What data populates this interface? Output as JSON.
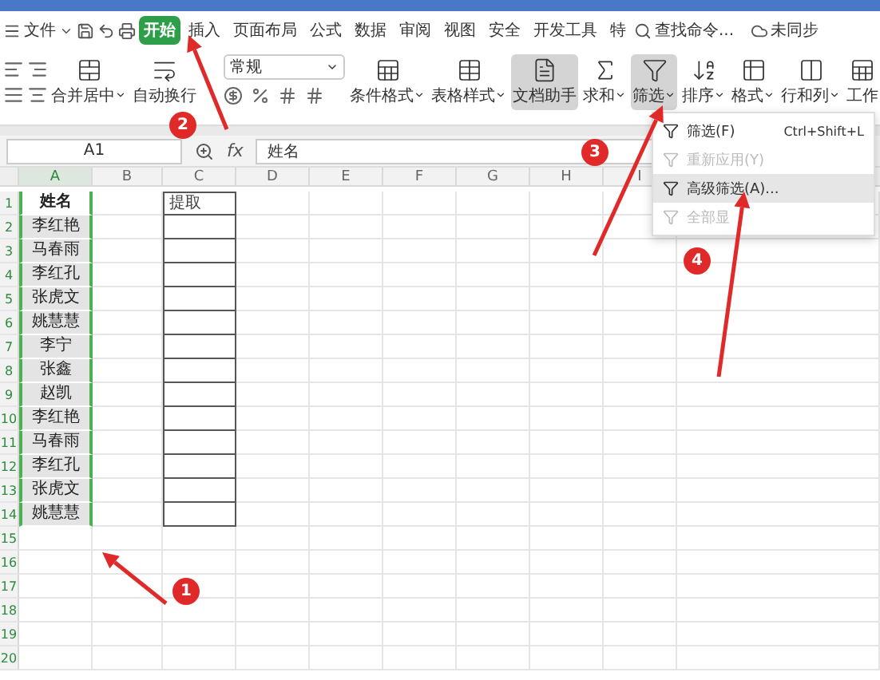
{
  "menu_bar": {
    "file_label": "文件",
    "tabs": [
      {
        "label": "开始",
        "selected": true
      },
      {
        "label": "插入",
        "selected": false
      },
      {
        "label": "页面布局",
        "selected": false
      },
      {
        "label": "公式",
        "selected": false
      },
      {
        "label": "数据",
        "selected": false
      },
      {
        "label": "审阅",
        "selected": false
      },
      {
        "label": "视图",
        "selected": false
      },
      {
        "label": "安全",
        "selected": false
      },
      {
        "label": "开发工具",
        "selected": false
      },
      {
        "label": "特",
        "selected": false
      }
    ],
    "search": "查找命令...",
    "sync": "未同步"
  },
  "ribbon": {
    "number_format": "常规",
    "buttons": [
      {
        "kind": "merge",
        "label": "合并居中",
        "dropdown": true,
        "pressed": false
      },
      {
        "kind": "wrap",
        "label": "自动换行",
        "dropdown": false,
        "pressed": false
      },
      {
        "kind": "conditional",
        "label": "条件格式",
        "dropdown": true,
        "pressed": false
      },
      {
        "kind": "tablestyle",
        "label": "表格样式",
        "dropdown": true,
        "pressed": false
      },
      {
        "kind": "assistant",
        "label": "文档助手",
        "dropdown": false,
        "pressed": true
      },
      {
        "kind": "sum",
        "label": "求和",
        "dropdown": true,
        "pressed": false
      },
      {
        "kind": "filter",
        "label": "筛选",
        "dropdown": true,
        "pressed": true
      },
      {
        "kind": "sort",
        "label": "排序",
        "dropdown": true,
        "pressed": false
      },
      {
        "kind": "format",
        "label": "格式",
        "dropdown": true,
        "pressed": false
      },
      {
        "kind": "rowcol",
        "label": "行和列",
        "dropdown": true,
        "pressed": false
      },
      {
        "kind": "sheet",
        "label": "工作",
        "dropdown": false,
        "pressed": false
      }
    ]
  },
  "formula_bar": {
    "name_box": "A1",
    "fx_label": "fx",
    "formula": "姓名"
  },
  "sheet": {
    "columns": [
      {
        "label": "A",
        "selected": true
      },
      {
        "label": "B",
        "selected": false
      },
      {
        "label": "C",
        "selected": false
      },
      {
        "label": "D",
        "selected": false
      },
      {
        "label": "E",
        "selected": false
      },
      {
        "label": "F",
        "selected": false
      },
      {
        "label": "G",
        "selected": false
      },
      {
        "label": "H",
        "selected": false
      },
      {
        "label": "I",
        "selected": false
      }
    ],
    "row_numbers": [
      "1",
      "2",
      "3",
      "4",
      "5",
      "6",
      "7",
      "8",
      "9",
      "10",
      "11",
      "12",
      "13",
      "14",
      "15",
      "16",
      "17",
      "18",
      "19",
      "20"
    ],
    "column_a": [
      "姓名",
      "李红艳",
      "马春雨",
      "李红孔",
      "张虎文",
      "姚慧慧",
      "李宁",
      "张鑫",
      "赵凯",
      "李红艳",
      "马春雨",
      "李红孔",
      "张虎文",
      "姚慧慧"
    ],
    "column_c": [
      "提取"
    ]
  },
  "filter_menu": [
    {
      "label": "筛选(F)",
      "shortcut": "Ctrl+Shift+L",
      "disabled": false,
      "highlighted": false
    },
    {
      "label": "重新应用(Y)",
      "disabled": true,
      "highlighted": false
    },
    {
      "label": "高级筛选(A)...",
      "disabled": false,
      "highlighted": true
    },
    {
      "label": "全部显",
      "disabled": true,
      "highlighted": false
    }
  ],
  "annotations": [
    {
      "number": "1"
    },
    {
      "number": "2"
    },
    {
      "number": "3"
    },
    {
      "number": "4"
    }
  ]
}
